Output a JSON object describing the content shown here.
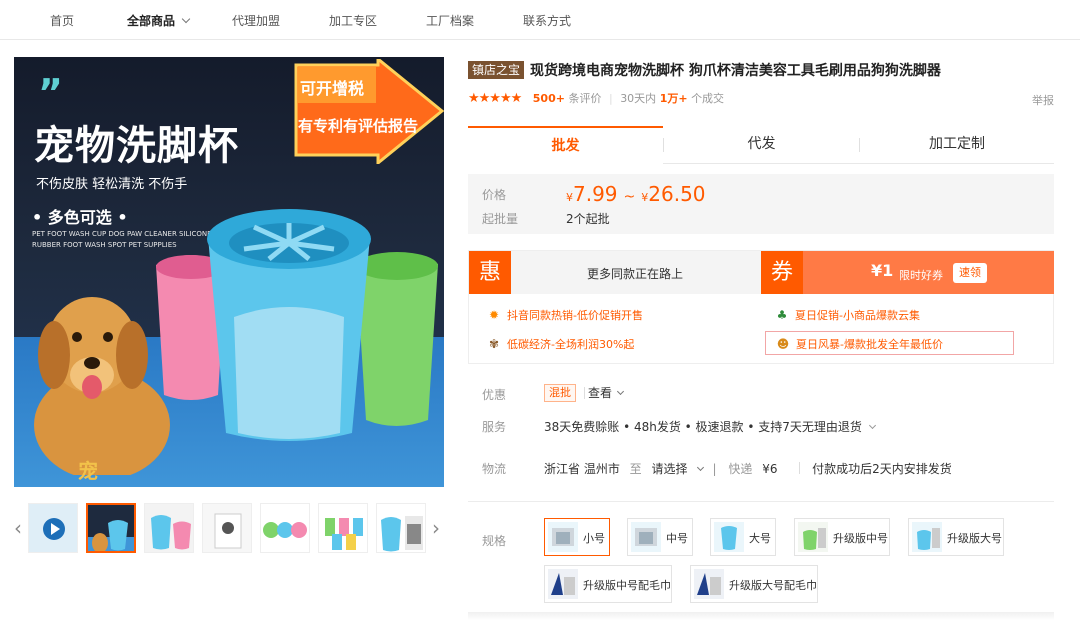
{
  "nav": {
    "items": [
      "首页",
      "全部商品",
      "代理加盟",
      "加工专区",
      "工厂档案",
      "联系方式"
    ],
    "active_index": 1
  },
  "gallery": {
    "main": {
      "quote": "”",
      "title": "宠物洗脚杯",
      "tagline": "不伤皮肤 轻松清洗 不伤手",
      "colors_label": "• 多色可选 •",
      "english": "PET FOOT WASH CUP DOG PAW CLEANER SILICONE RUBBER FOOT WASH SPOT PET SUPPLIES",
      "banner_line1": "可开增税",
      "banner_line2": "有专利有评估报告",
      "logo_text": "宠"
    },
    "thumbnail_count": 7,
    "selected_thumb": 1,
    "prev_icon": "chevron-left-icon",
    "next_icon": "chevron-right-icon"
  },
  "product": {
    "store_tag": "镇店之宝",
    "title": "现货跨境电商宠物洗脚杯 狗爪杯清洁美容工具毛刷用品狗狗洗脚器",
    "stars": "★★★★★",
    "reviews_count": "500+",
    "reviews_label": "条评价",
    "sales_period": "30天内",
    "sales_count": "1万+",
    "sales_label": "个成交",
    "report": "举报"
  },
  "tabs": [
    "批发",
    "代发",
    "加工定制"
  ],
  "pricing": {
    "price_label": "价格",
    "currency": "¥",
    "min": "7.99",
    "tilde": "~",
    "max": "26.50",
    "moq_label": "起批量",
    "moq_value": "2个起批"
  },
  "promo": {
    "hui_badge": "惠",
    "more_label": "更多同款正在路上",
    "quan_badge": "券",
    "coupon_amount": "¥1",
    "coupon_label": "限时好券",
    "coupon_button": "速领",
    "items": [
      {
        "text": "抖音同款热销-低价促销开售",
        "icon": "sun-icon"
      },
      {
        "text": "夏日促销-小商品爆款云集",
        "icon": "leaf-icon"
      },
      {
        "text": "低碳经济-全场利润30%起",
        "icon": "sprout-icon"
      },
      {
        "text": "夏日风暴-爆款批发全年最低价",
        "icon": "bear-icon"
      }
    ]
  },
  "details": {
    "discount_label": "优惠",
    "discount_tag": "混批",
    "view_label": "查看",
    "service_label": "服务",
    "service_text": "38天免费赊账 • 48h发货 • 极速退款 • 支持7天无理由退货",
    "logistics_label": "物流",
    "origin": "浙江省 温州市",
    "to": "至",
    "destination": "请选择",
    "express": "快递",
    "express_price": "¥6",
    "ship_note": "付款成功后2天内安排发货"
  },
  "specs": {
    "label": "规格",
    "options": [
      "小号",
      "中号",
      "大号",
      "升级版中号",
      "升级版大号",
      "升级版中号配毛巾",
      "升级版大号配毛巾"
    ],
    "selected_index": 0
  },
  "colors": {
    "accent": "#ff5a00",
    "coupon_bg": "#ff7a45",
    "store_tag_bg": "#7a5230"
  }
}
